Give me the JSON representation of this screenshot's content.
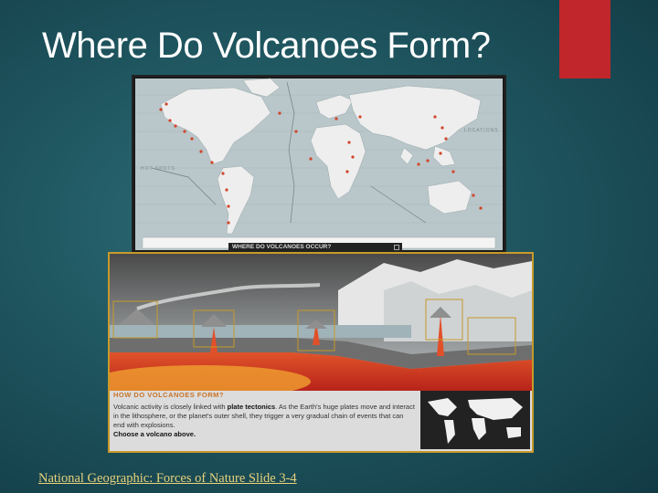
{
  "slide": {
    "title": "Where Do Volcanoes Form?",
    "source_link": "National Geographic: Forces of Nature Slide 3-4",
    "accent_color": "#c0262b"
  },
  "map": {
    "caption": "WHERE DO VOLCANOES OCCUR?",
    "label_left": "HOT SPOTS",
    "label_right": "LOCATIONS"
  },
  "diagram": {
    "heading": "HOW DO VOLCANOES FORM?",
    "body_pre": "Volcanic activity is closely linked with ",
    "body_bold": "plate tectonics",
    "body_post": ". As the Earth's huge plates move and interact in the lithosphere, or the planet's outer shell, they trigger a very gradual chain of events that can end with explosions.",
    "cta": "Choose a volcano above."
  }
}
